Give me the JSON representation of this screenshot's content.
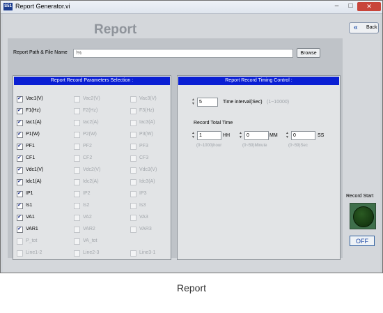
{
  "window": {
    "title": "Report Generator.vi",
    "icon_text": "S51"
  },
  "heading": "Report",
  "back_button": {
    "label": "Back"
  },
  "path": {
    "label": "Report Path & File Name",
    "value": "\\%",
    "browse": "Browse"
  },
  "params": {
    "header": "Report Record Parameters Selection :",
    "rows": [
      [
        {
          "label": "Vac1(V)",
          "checked": true
        },
        {
          "label": "Vac2(V)",
          "checked": false
        },
        {
          "label": "Vac3(V)",
          "checked": false
        }
      ],
      [
        {
          "label": "F1(Hz)",
          "checked": true
        },
        {
          "label": "F2(Hz)",
          "checked": false
        },
        {
          "label": "F3(Hz)",
          "checked": false
        }
      ],
      [
        {
          "label": "Iac1(A)",
          "checked": true
        },
        {
          "label": "Iac2(A)",
          "checked": false
        },
        {
          "label": "Iac3(A)",
          "checked": false
        }
      ],
      [
        {
          "label": "P1(W)",
          "checked": true
        },
        {
          "label": "P2(W)",
          "checked": false
        },
        {
          "label": "P3(W)",
          "checked": false
        }
      ],
      [
        {
          "label": "PF1",
          "checked": true
        },
        {
          "label": "PF2",
          "checked": false
        },
        {
          "label": "PF3",
          "checked": false
        }
      ],
      [
        {
          "label": "CF1",
          "checked": true
        },
        {
          "label": "CF2",
          "checked": false
        },
        {
          "label": "CF3",
          "checked": false
        }
      ],
      [
        {
          "label": "Vdc1(V)",
          "checked": true
        },
        {
          "label": "Vdc2(V)",
          "checked": false
        },
        {
          "label": "Vdc3(V)",
          "checked": false
        }
      ],
      [
        {
          "label": "Idc1(A)",
          "checked": true
        },
        {
          "label": "Idc2(A)",
          "checked": false
        },
        {
          "label": "Idc3(A)",
          "checked": false
        }
      ],
      [
        {
          "label": "IP1",
          "checked": true
        },
        {
          "label": "IP2",
          "checked": false
        },
        {
          "label": "IP3",
          "checked": false
        }
      ],
      [
        {
          "label": "Is1",
          "checked": true
        },
        {
          "label": "Is2",
          "checked": false
        },
        {
          "label": "Is3",
          "checked": false
        }
      ],
      [
        {
          "label": "VA1",
          "checked": true
        },
        {
          "label": "VA2",
          "checked": false
        },
        {
          "label": "VA3",
          "checked": false
        }
      ],
      [
        {
          "label": "VAR1",
          "checked": true
        },
        {
          "label": "VAR2",
          "checked": false
        },
        {
          "label": "VAR3",
          "checked": false
        }
      ],
      [
        {
          "label": "P_tot",
          "checked": false
        },
        {
          "label": "VA_tot",
          "checked": false
        }
      ],
      [
        {
          "label": "Line1-2",
          "checked": false
        },
        {
          "label": "Line2-3",
          "checked": false
        },
        {
          "label": "Line3-1",
          "checked": false
        }
      ]
    ]
  },
  "timing": {
    "header": "Report Record Timing Control :",
    "interval": {
      "value": "5",
      "label": "Time interval(Sec)",
      "range": "(1~10000)"
    },
    "total_label": "Record Total Time",
    "hh": {
      "value": "1",
      "unit": "HH",
      "hint": "(0~1000)hour"
    },
    "mm": {
      "value": "0",
      "unit": "MM",
      "hint": "(0~59)Minute"
    },
    "ss": {
      "value": "0",
      "unit": "SS",
      "hint": "(0~59)Sec"
    }
  },
  "record": {
    "label": "Record Start",
    "state": "OFF"
  },
  "caption": "Report"
}
